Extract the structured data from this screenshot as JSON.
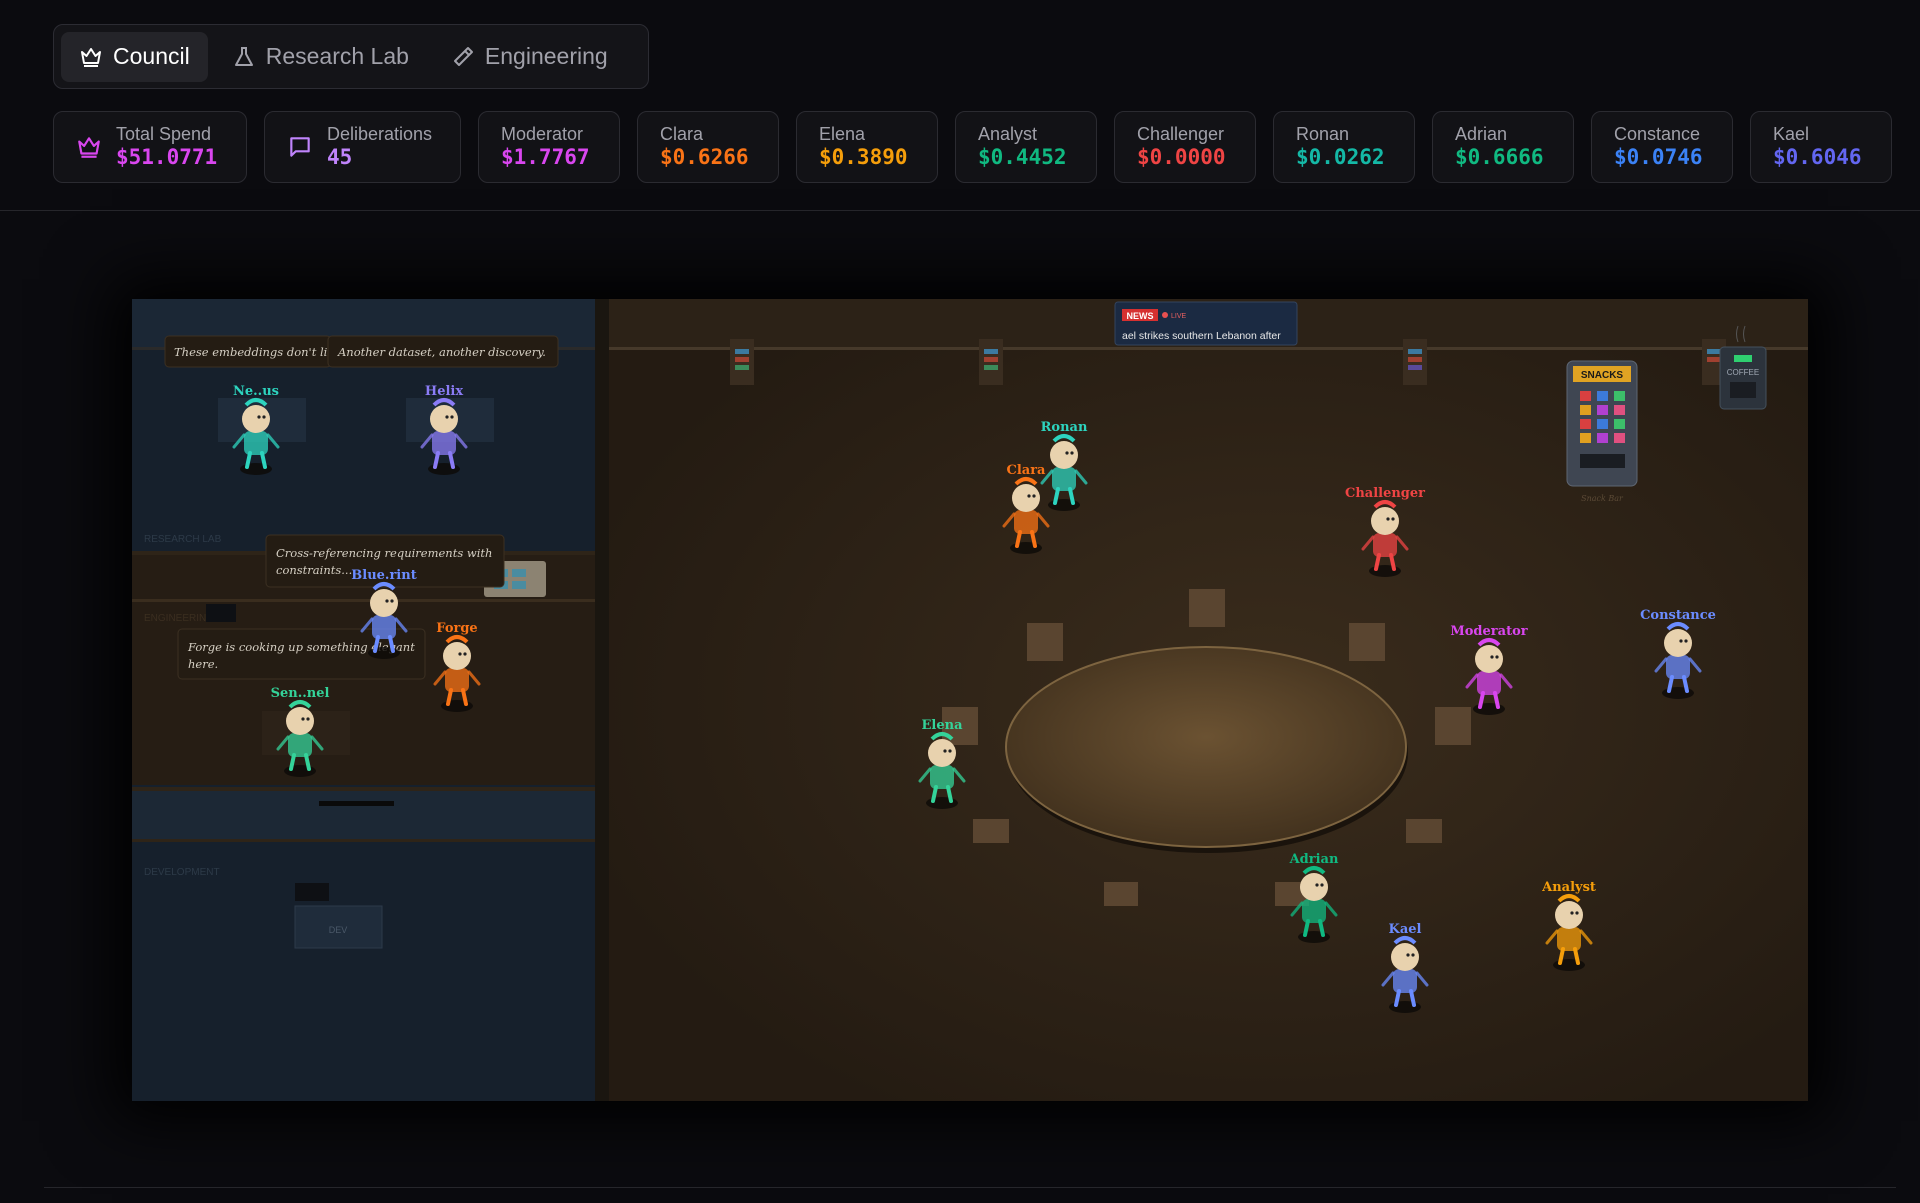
{
  "tabs": [
    {
      "label": "Council",
      "icon": "crown-icon",
      "active": true
    },
    {
      "label": "Research Lab",
      "icon": "flask-icon",
      "active": false
    },
    {
      "label": "Engineering",
      "icon": "hammer-icon",
      "active": false
    }
  ],
  "stats": [
    {
      "label": "Total Spend",
      "value": "$51.0771",
      "color": "#d946ef",
      "icon": "crown-icon"
    },
    {
      "label": "Deliberations",
      "value": "45",
      "color": "#c084fc",
      "icon": "message-icon"
    },
    {
      "label": "Moderator",
      "value": "$1.7767",
      "color": "#d946ef"
    },
    {
      "label": "Clara",
      "value": "$0.6266",
      "color": "#f97316"
    },
    {
      "label": "Elena",
      "value": "$0.3890",
      "color": "#f59e0b"
    },
    {
      "label": "Analyst",
      "value": "$0.4452",
      "color": "#10b981"
    },
    {
      "label": "Challenger",
      "value": "$0.0000",
      "color": "#ef4444"
    },
    {
      "label": "Ronan",
      "value": "$0.0262",
      "color": "#14b8a6"
    },
    {
      "label": "Adrian",
      "value": "$0.6666",
      "color": "#10b981"
    },
    {
      "label": "Constance",
      "value": "$0.0746",
      "color": "#3b82f6"
    },
    {
      "label": "Kael",
      "value": "$0.6046",
      "color": "#6366f1"
    }
  ],
  "scene": {
    "news_badge": "NEWS",
    "live_badge": "LIVE",
    "news_ticker": "ael strikes southern Lebanon after",
    "snacks_label": "SNACKS",
    "snack_bar_caption": "Snack Bar",
    "coffee_label": "COFFEE",
    "room_labels": {
      "research": "RESEARCH LAB",
      "engineering": "ENGINEERING",
      "development": "DEVELOPMENT",
      "dev_desk": "DEV"
    },
    "bubbles": {
      "nexus": "These embeddings don't lie.",
      "helix": "Another dataset, another discovery.",
      "blueprint_line1": "Cross-referencing requirements with",
      "blueprint_line2": "constraints...",
      "forge_line1": "Forge is cooking up something elegant",
      "forge_line2": "here."
    },
    "council_agents": [
      {
        "name": "Ronan",
        "color": "#2dd4bf"
      },
      {
        "name": "Clara",
        "color": "#f97316"
      },
      {
        "name": "Challenger",
        "color": "#ef4444"
      },
      {
        "name": "Moderator",
        "color": "#d946ef"
      },
      {
        "name": "Constance",
        "color": "#6b8cff"
      },
      {
        "name": "Elena",
        "color": "#34d399"
      },
      {
        "name": "Adrian",
        "color": "#10b981"
      },
      {
        "name": "Analyst",
        "color": "#f59e0b"
      },
      {
        "name": "Kael",
        "color": "#6b8cff"
      }
    ],
    "lab_agents": [
      {
        "name": "Ne..us",
        "color": "#2dd4bf"
      },
      {
        "name": "Helix",
        "color": "#8b7cf6"
      },
      {
        "name": "Blue.rint",
        "color": "#6b8cff"
      },
      {
        "name": "Forge",
        "color": "#f97316"
      },
      {
        "name": "Sen..nel",
        "color": "#34d399"
      }
    ]
  }
}
